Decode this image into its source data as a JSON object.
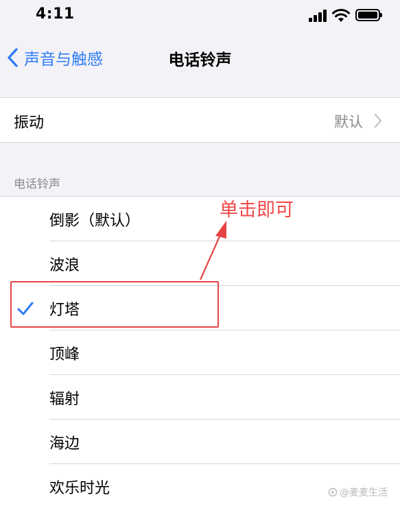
{
  "status_bar": {
    "time": "4:11"
  },
  "nav": {
    "back_label": "声音与触感",
    "title": "电话铃声"
  },
  "vibration": {
    "label": "振动",
    "value": "默认"
  },
  "section_header": "电话铃声",
  "ringtones": [
    {
      "label": "倒影（默认）",
      "selected": false
    },
    {
      "label": "波浪",
      "selected": false
    },
    {
      "label": "灯塔",
      "selected": true
    },
    {
      "label": "顶峰",
      "selected": false
    },
    {
      "label": "辐射",
      "selected": false
    },
    {
      "label": "海边",
      "selected": false
    },
    {
      "label": "欢乐时光",
      "selected": false
    }
  ],
  "annotation": {
    "text": "单击即可",
    "color": "#f04848"
  },
  "watermark": "@麦麦生活",
  "colors": {
    "accent": "#2f7cf6",
    "background": "#f2f2f7",
    "annotation_red": "#e64444"
  },
  "icons": [
    "cellular-signal-icon",
    "wifi-icon",
    "battery-icon",
    "back-chevron-icon",
    "disclosure-chevron-icon",
    "checkmark-icon"
  ]
}
